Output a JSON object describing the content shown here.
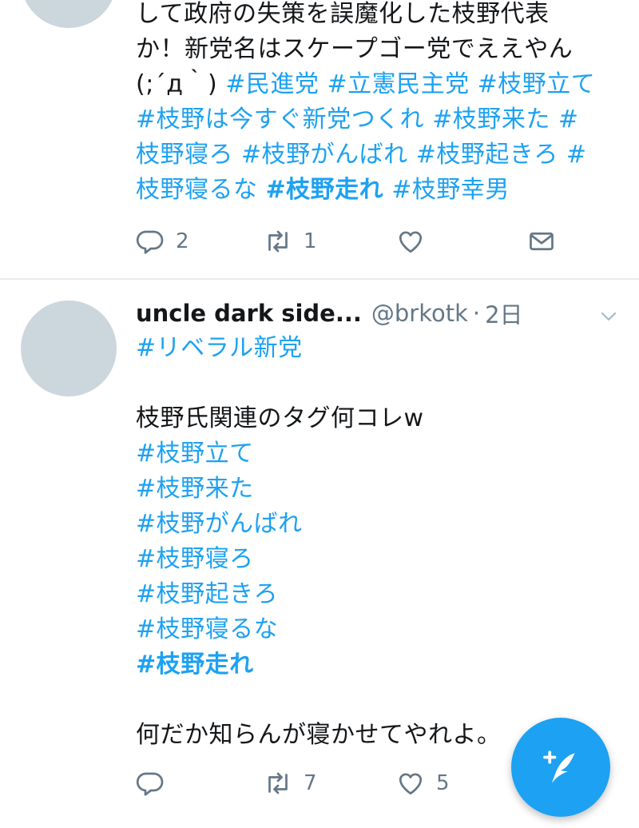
{
  "tweet1": {
    "lines": [
      [
        {
          "t": "して政府の失策を誤魔化した枝野代表",
          "c": "text"
        }
      ],
      [
        {
          "t": "か！新党名はスケープゴー党でええやん",
          "c": "text"
        }
      ],
      [
        {
          "t": "(;´д｀) ",
          "c": "text"
        },
        {
          "t": "#民進党",
          "c": "hl"
        },
        {
          "t": " ",
          "c": "text"
        },
        {
          "t": "#立憲民主党",
          "c": "hl"
        },
        {
          "t": " ",
          "c": "text"
        },
        {
          "t": "#枝野立て",
          "c": "hl"
        }
      ],
      [
        {
          "t": "#枝野は今すぐ新党つくれ",
          "c": "hl"
        },
        {
          "t": " ",
          "c": "text"
        },
        {
          "t": "#枝野来た",
          "c": "hl"
        },
        {
          "t": " ",
          "c": "text"
        },
        {
          "t": "#",
          "c": "hl"
        }
      ],
      [
        {
          "t": "枝野寝ろ",
          "c": "hl"
        },
        {
          "t": " ",
          "c": "text"
        },
        {
          "t": "#枝野がんばれ",
          "c": "hl"
        },
        {
          "t": " ",
          "c": "text"
        },
        {
          "t": "#枝野起きろ",
          "c": "hl"
        },
        {
          "t": " ",
          "c": "text"
        },
        {
          "t": "#",
          "c": "hl"
        }
      ],
      [
        {
          "t": "枝野寝るな",
          "c": "hl"
        },
        {
          "t": " ",
          "c": "text"
        },
        {
          "t": "#枝野走れ",
          "c": "hlb"
        },
        {
          "t": " ",
          "c": "text"
        },
        {
          "t": "#枝野幸男",
          "c": "hl"
        }
      ]
    ],
    "reply_count": "2",
    "retweet_count": "1",
    "like_count": ""
  },
  "tweet2": {
    "name": "uncle dark side...",
    "handle": "@brkotk",
    "separator": "·",
    "time": "2日",
    "lines": [
      [
        {
          "t": "#リベラル新党",
          "c": "hl"
        }
      ],
      [],
      [
        {
          "t": "枝野氏関連のタグ何コレw",
          "c": "text"
        }
      ],
      [
        {
          "t": "#枝野立て",
          "c": "hl"
        }
      ],
      [
        {
          "t": "#枝野来た",
          "c": "hl"
        }
      ],
      [
        {
          "t": "#枝野がんばれ",
          "c": "hl"
        }
      ],
      [
        {
          "t": "#枝野寝ろ",
          "c": "hl"
        }
      ],
      [
        {
          "t": "#枝野起きろ",
          "c": "hl"
        }
      ],
      [
        {
          "t": "#枝野寝るな",
          "c": "hl"
        }
      ],
      [
        {
          "t": "#枝野走れ",
          "c": "hlb"
        }
      ],
      [],
      [
        {
          "t": "何だか知らんが寝かせてやれよ。",
          "c": "text"
        }
      ]
    ],
    "reply_count": "",
    "retweet_count": "7",
    "like_count": "5"
  },
  "icons": {
    "reply": "reply-icon",
    "retweet": "retweet-icon",
    "like": "heart-icon",
    "dm": "envelope-icon",
    "caret": "chevron-down-icon",
    "compose": "compose-tweet-icon"
  },
  "colors": {
    "accent": "#1da1f2",
    "muted": "#657786",
    "avatar": "#ccd6dd",
    "divider": "#e6ecf0"
  }
}
